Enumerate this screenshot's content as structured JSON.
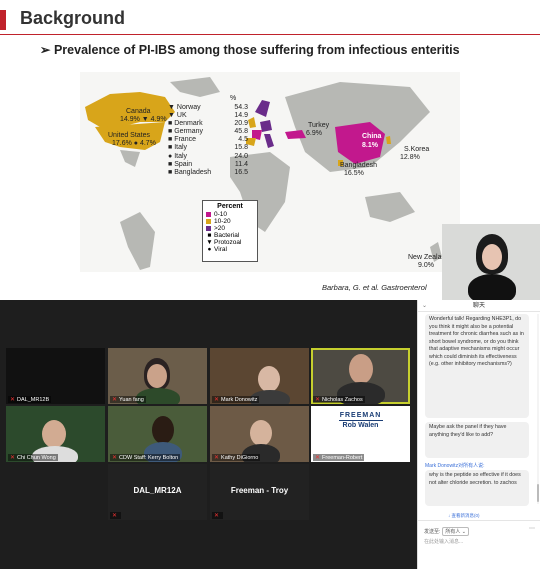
{
  "slide": {
    "title": "Background",
    "subtitle": "Prevalence of PI-IBS among those suffering from infectious enteritis",
    "bullet_glyph": "➢",
    "citation": "Barbara, G. et al. Gastroenterol",
    "percent_header": "%",
    "stats": [
      {
        "sym": "▼",
        "country": "Norway",
        "value": "54.3"
      },
      {
        "sym": "▼",
        "country": "UK",
        "value": "14.9"
      },
      {
        "sym": "■",
        "country": "Denmark",
        "value": "20.9"
      },
      {
        "sym": "■",
        "country": "Germany",
        "value": "45.8"
      },
      {
        "sym": "■",
        "country": "France",
        "value": "4.5"
      },
      {
        "sym": "■",
        "country": "Italy",
        "value": "15.8"
      },
      {
        "sym": "●",
        "country": "Italy",
        "value": "24.0"
      },
      {
        "sym": "■",
        "country": "Spain",
        "value": "11.4"
      },
      {
        "sym": "■",
        "country": "Bangladesh",
        "value": "16.5"
      }
    ],
    "map_labels": {
      "canada": "Canada",
      "canada_vals": "14.9% ▼ 4.9%",
      "us": "United States",
      "us_vals": "17.6% ● 4.7%",
      "turkey": "Turkey",
      "turkey_val": "6.9%",
      "china": "China",
      "china_val": "8.1%",
      "skorea": "S.Korea",
      "skorea_val": "12.8%",
      "bangladesh": "Bangladesh",
      "bangladesh_val": "16.5%",
      "nz": "New Zeala",
      "nz_val": "9.0%"
    },
    "legend": {
      "title": "Percent",
      "ranges": [
        {
          "label": "0-10",
          "color": "#c2188d"
        },
        {
          "label": "10-20",
          "color": "#d8a51a"
        },
        {
          "label": ">20",
          "color": "#6a2c8a"
        }
      ],
      "types": [
        {
          "sym": "■",
          "label": "Bacterial"
        },
        {
          "sym": "▼",
          "label": "Protozoal"
        },
        {
          "sym": "●",
          "label": "Viral"
        }
      ]
    }
  },
  "participants": [
    {
      "name": "DAL_MR12B"
    },
    {
      "name": "Yuan fang"
    },
    {
      "name": "Mark Donowitz"
    },
    {
      "name": "Nicholas Zachos"
    },
    {
      "name": "Chi Chun Wong"
    },
    {
      "name": "CDW Staff: Kerry Bolton"
    },
    {
      "name": "Kathy DiGiorno"
    },
    {
      "name": "Freeman-Robert"
    },
    {
      "name": "DAL_MR12A"
    },
    {
      "name": "Freeman - Troy"
    }
  ],
  "freeman_tile": {
    "brand": "FREEMAN",
    "person": "Rob Walen"
  },
  "chat": {
    "header": "聊天",
    "messages": [
      {
        "text": "Wonderful talk! Regarding NHE3P1, do you think it might also be a potential treatment for chronic diarrhea such as in short bowel syndrome, or do you think that adaptive mechanisms might occur which could diminish its effectiveness (e.g. other inhibitory mechanisms?)"
      },
      {
        "text": "Maybe ask the panel if they have anything they'd like to add?"
      },
      {
        "text": "why is the peptide so effective if it does not alter chloride secretion. to zachos"
      }
    ],
    "sender_line": "Mark Donowitz对所有人说:",
    "unread": "↓ 查看新消息(0)",
    "send_to_label": "发送至:",
    "send_to_value": "所有人 ⌄",
    "input_placeholder": "在此处输入消息..."
  },
  "colors": {
    "accent": "#c0222b",
    "active_speaker": "#c6cf2e",
    "link": "#3a6fd8"
  }
}
